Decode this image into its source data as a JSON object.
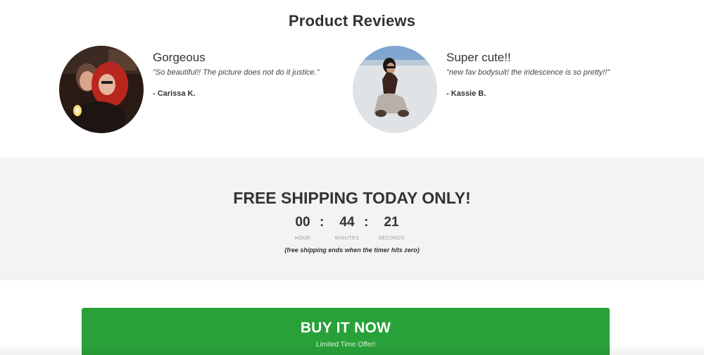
{
  "reviews": {
    "title": "Product Reviews",
    "items": [
      {
        "title": "Gorgeous",
        "quote": "\"So beautiful!! The picture does not do it justice.\"",
        "author": "- Carissa K."
      },
      {
        "title": "Super cute!!",
        "quote": "\"new fav bodysuit! the iridescence is so pretty!!\"",
        "author": "- Kassie B."
      }
    ]
  },
  "shipping": {
    "title": "FREE SHIPPING TODAY ONLY!",
    "timer": {
      "hour": "00",
      "minutes": "44",
      "seconds": "21",
      "separator": ":",
      "hour_label": "HOUR",
      "minutes_label": "MINUTES",
      "seconds_label": "SECONDS"
    },
    "note": "(free shipping ends when the timer hits zero)"
  },
  "buy": {
    "label": "BUY IT NOW",
    "sublabel": "Limited Time Offer!"
  },
  "colors": {
    "button_green": "#28a139",
    "band_gray": "#f3f3f3",
    "text_dark": "#333333"
  }
}
